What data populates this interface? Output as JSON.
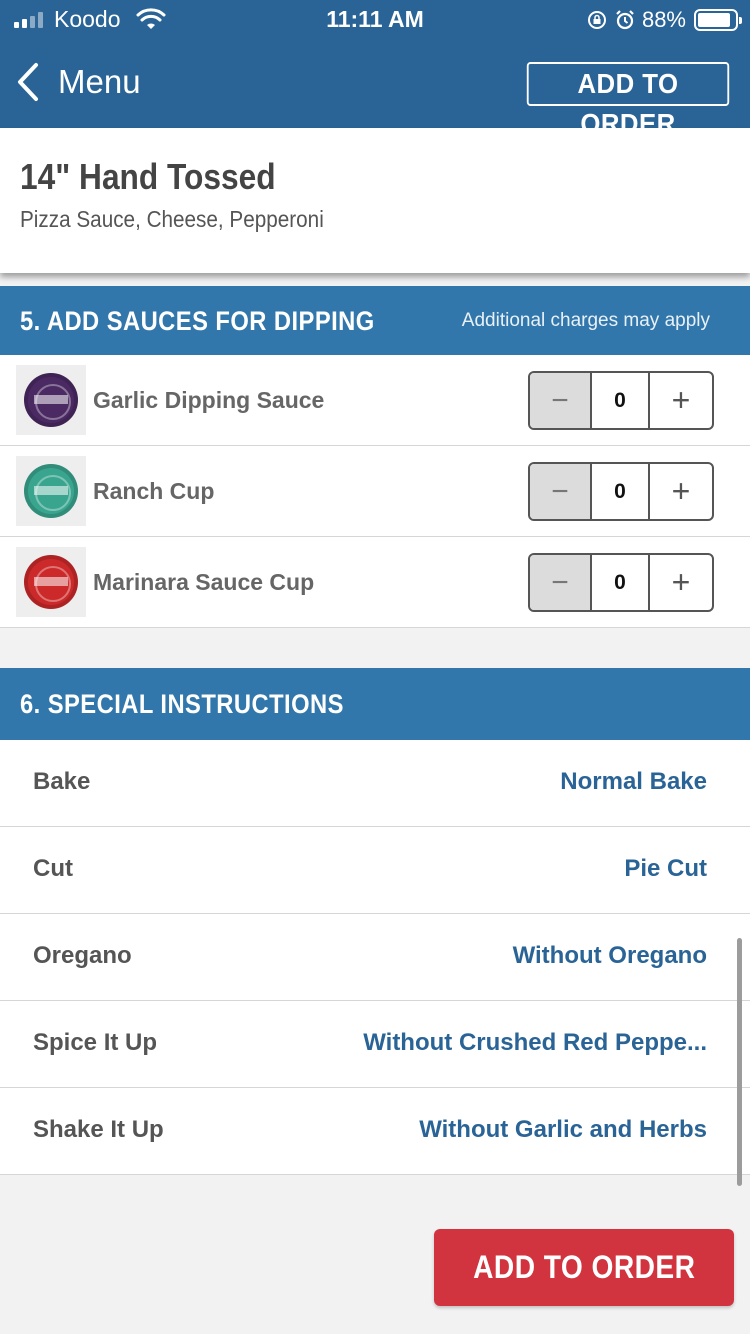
{
  "status_bar": {
    "carrier": "Koodo",
    "time": "11:11 AM",
    "battery_percent": "88%",
    "battery_level": 0.88,
    "signal_bars_active": 2,
    "signal_bars_total": 4
  },
  "nav": {
    "back_label": "Menu",
    "add_button": "ADD TO ORDER"
  },
  "product": {
    "title": "14\" Hand Tossed",
    "subtitle": "Pizza Sauce, Cheese, Pepperoni"
  },
  "sauces_section": {
    "title": "5. ADD SAUCES FOR DIPPING",
    "note": "Additional charges may apply",
    "items": [
      {
        "name": "Garlic Dipping Sauce",
        "quantity": "0",
        "minus": "−",
        "plus": "+",
        "color": "#4b2a63"
      },
      {
        "name": "Ranch Cup",
        "quantity": "0",
        "minus": "−",
        "plus": "+",
        "color": "#3aa58f"
      },
      {
        "name": "Marinara Sauce Cup",
        "quantity": "0",
        "minus": "−",
        "plus": "+",
        "color": "#cc2a2a"
      }
    ]
  },
  "instructions_section": {
    "title": "6. SPECIAL INSTRUCTIONS",
    "items": [
      {
        "label": "Bake",
        "value": "Normal Bake"
      },
      {
        "label": "Cut",
        "value": "Pie Cut"
      },
      {
        "label": "Oregano",
        "value": "Without Oregano"
      },
      {
        "label": "Spice It Up",
        "value": "Without Crushed Red Peppe..."
      },
      {
        "label": "Shake It Up",
        "value": "Without Garlic and Herbs"
      }
    ]
  },
  "cta": {
    "label": "ADD TO ORDER"
  },
  "colors": {
    "header_blue": "#2a6496",
    "section_blue": "#3277ab",
    "link_blue": "#2a6496",
    "cta_red": "#d1343f"
  }
}
